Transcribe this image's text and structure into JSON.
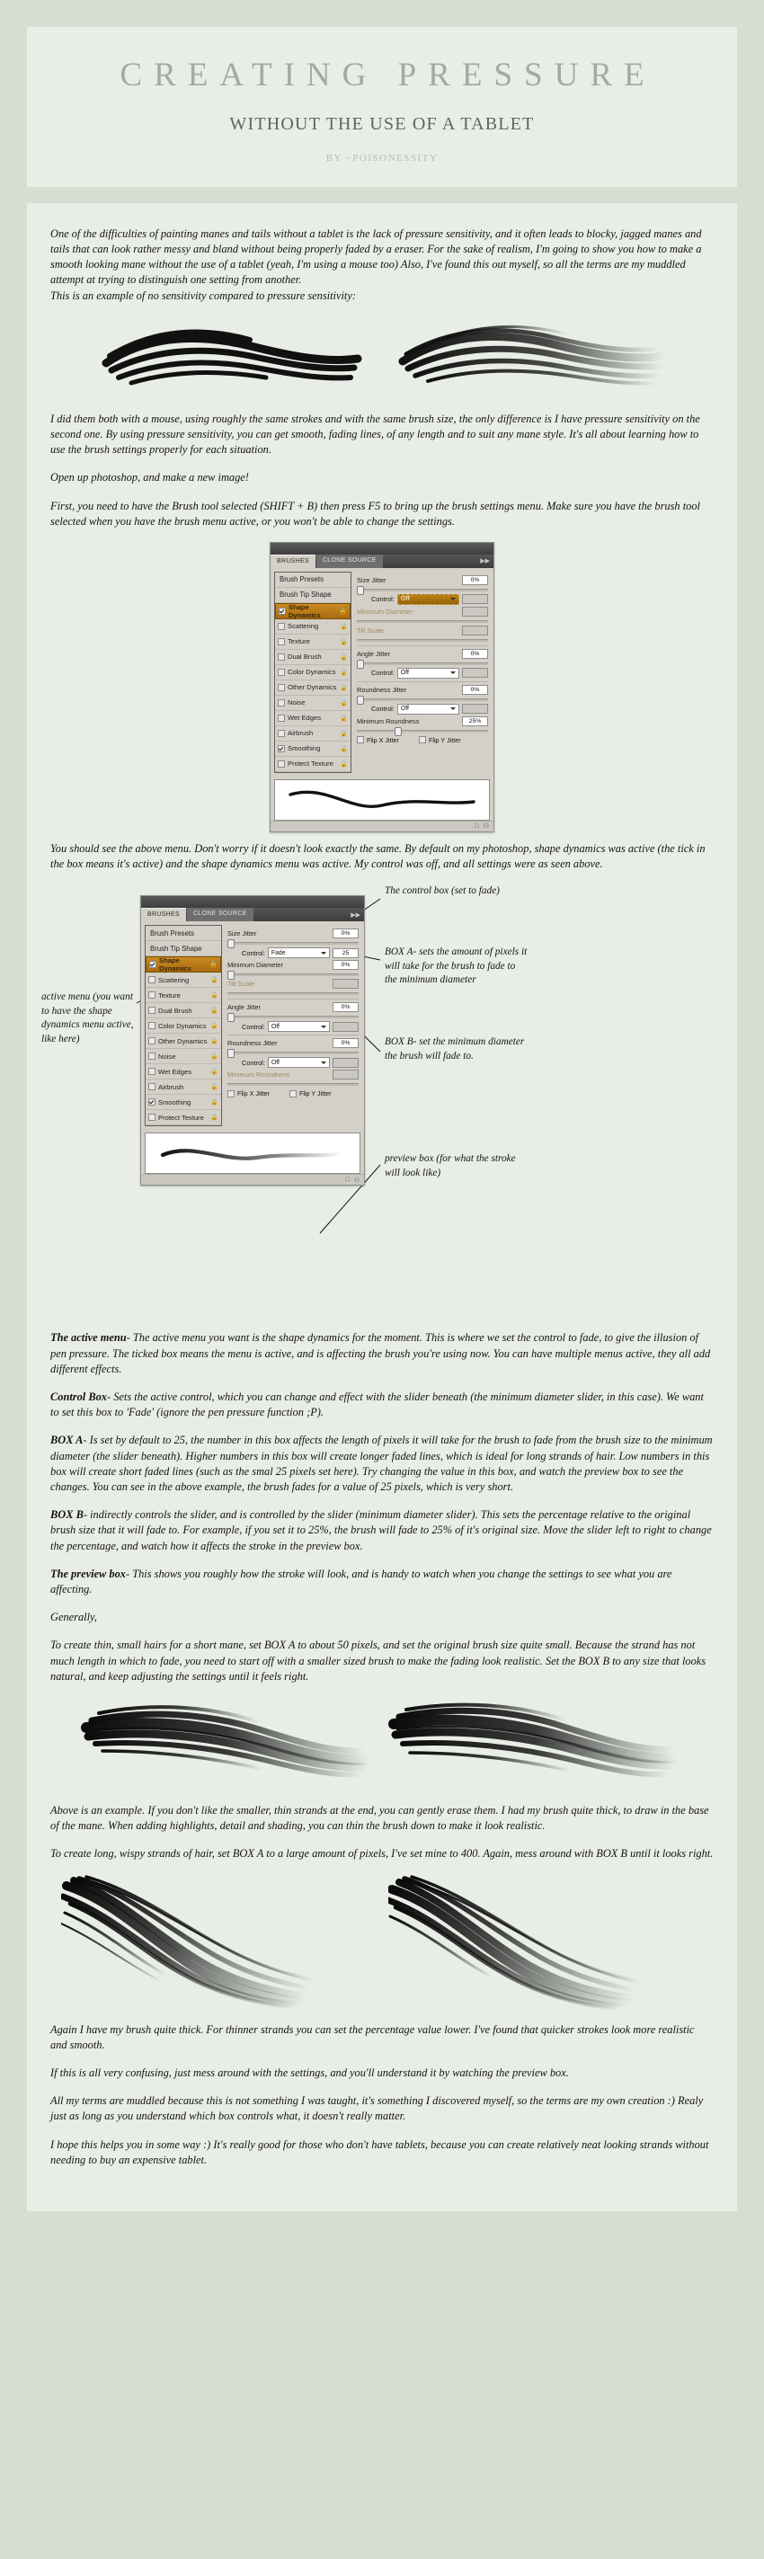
{
  "banner": {
    "title": "CREATING PRESSURE",
    "subtitle": "WITHOUT THE USE OF A TABLET",
    "byline": "BY ~POISONESSITY"
  },
  "colors": {
    "page_background": "#d6ded2",
    "sheet_background": "#e8eee6",
    "title_text": "#a3aaa1",
    "subtitle_text": "#5e6460",
    "body_text": "#15120e",
    "photoshop_panel": "#d4d0c8",
    "photoshop_highlight": "#b5791a"
  },
  "paragraphs": {
    "intro": "One of the difficulties of painting manes and tails without a tablet is the lack of pressure sensitivity, and it often leads to blocky, jagged manes and tails that can look rather messy and bland without being properly faded by a eraser. For the sake of realism, I'm going to show you how to make a smooth looking mane without the use of a tablet (yeah, I'm using a mouse too) Also, I've found this out myself, so all the terms are my muddled attempt at trying to distinguish one setting from another.",
    "example_caption": "This is an example of no sensitivity compared to pressure sensitivity:",
    "after_example": "I did them both with a mouse, using roughly the same strokes and with the same brush size, the only difference is I have pressure sensitivity on the second one.  By using pressure sensitivity, you can get smooth, fading lines, of any length and to suit any mane style. It's all about learning how to use the brush settings properly for each situation.",
    "open_photoshop": "Open up photoshop, and make a new image!",
    "first_step": "First, you need to have the Brush tool selected (SHIFT + B) then press F5 to bring up the brush settings menu. Make sure you have the brush tool selected when you have the brush menu active, or you won't be able to change the settings.",
    "after_panel1": "You should see the above menu. Don't worry if it doesn't look exactly the same. By default on my photoshop, shape dynamics was active (the tick in the box means it's active) and the shape dynamics menu was active. My control was off,  and all settings were as seen above.",
    "generally": "Generally,",
    "thin_hairs": "To create thin, small hairs for a short mane, set BOX A to about 50 pixels, and set the original brush size quite small. Because the strand has not much length in which to fade, you need to start off with a smaller sized brush to make the fading look realistic. Set the BOX B to any size that looks natural, and keep adjusting the settings until it feels right.",
    "above_example": "Above is an example. If you don't like the smaller, thin strands at the end, you can gently erase them. I had my brush quite thick, to draw in the base of the mane. When adding highlights, detail and shading, you can thin the brush down to make it look realistic.",
    "long_wispy": "To create long, wispy strands of hair, set BOX A to a large amount of pixels, I've set mine to 400. Again, mess around with BOX B until it looks right.",
    "again_thick": "Again I have my brush quite thick. For thinner strands you can set the percentage value lower. I've found that quicker strokes look more realistic and smooth.",
    "confusing": "If this is all very confusing, just mess around with the settings, and you'll understand it by watching the preview box.",
    "muddled_terms": "All my terms are muddled because this is not something I was taught, it's something I discovered myself, so the terms are my own creation :) Realy just as long as you understand which box controls what, it doesn't really matter.",
    "closing": "I hope this helps you in some way :) It's really good for those who don't have tablets, because you can create relatively neat looking strands without needing to buy an expensive tablet."
  },
  "definitions": [
    {
      "term": "The active menu",
      "text": "- The active menu you want is the shape dynamics for the moment. This is where we set the control to fade, to give the illusion of pen pressure. The ticked box means the menu is active, and is affecting the brush you're using now. You can have multiple menus active, they all add different effects."
    },
    {
      "term": "Control Box",
      "text": "- Sets the active control, which you can change and effect with the slider beneath (the minimum diameter slider, in this case). We want to set this box to 'Fade' (ignore the pen pressure function ;P)."
    },
    {
      "term": "BOX A",
      "text": "- Is set by default to 25, the number in this box affects the length of pixels it will take for the brush to fade from the brush size to the minimum diameter (the slider beneath). Higher numbers in this box will create longer faded lines, which is ideal for long strands of hair. Low numbers in this box will create short faded lines (such as the smal 25 pixels set here). Try changing the value in this box, and watch the preview box to see the changes. You can see in the above example, the brush fades for a value of 25 pixels, which is very short."
    },
    {
      "term": "BOX B",
      "text": "- indirectly controls the slider, and is controlled by the slider (minimum diameter slider). This sets the percentage relative to the original brush size that it will fade to. For example, if you set it to 25%, the brush will fade to 25% of it's original size. Move the slider left to right to change the percentage, and watch how it affects the stroke in the preview box."
    },
    {
      "term": "The preview box",
      "text": "- This shows you roughly how the stroke will look, and is handy to watch when you change the settings to see what you are affecting."
    }
  ],
  "panel1": {
    "tabs": {
      "active": "BRUSHES",
      "inactive": "CLONE SOURCE"
    },
    "left_items": [
      {
        "label": "Brush Presets",
        "checkbox": "none",
        "selected": false
      },
      {
        "label": "Brush Tip Shape",
        "checkbox": "none",
        "selected": false
      },
      {
        "label": "Shape Dynamics",
        "checkbox": "checked",
        "selected": true
      },
      {
        "label": "Scattering",
        "checkbox": "unchecked",
        "selected": false
      },
      {
        "label": "Texture",
        "checkbox": "unchecked",
        "selected": false
      },
      {
        "label": "Dual Brush",
        "checkbox": "unchecked",
        "selected": false
      },
      {
        "label": "Color Dynamics",
        "checkbox": "unchecked",
        "selected": false
      },
      {
        "label": "Other Dynamics",
        "checkbox": "unchecked",
        "selected": false
      },
      {
        "label": "Noise",
        "checkbox": "unchecked",
        "selected": false
      },
      {
        "label": "Wet Edges",
        "checkbox": "unchecked",
        "selected": false
      },
      {
        "label": "Airbrush",
        "checkbox": "unchecked",
        "selected": false
      },
      {
        "label": "Smoothing",
        "checkbox": "checked",
        "selected": false
      },
      {
        "label": "Protect Texture",
        "checkbox": "unchecked",
        "selected": false
      }
    ],
    "size_jitter_label": "Size Jitter",
    "size_jitter_value": "0%",
    "control_label": "Control:",
    "control_value": "Off",
    "minimum_diameter_label": "Minimum Diameter",
    "minimum_diameter_value": "",
    "tilt_scale_label": "Tilt Scale",
    "tilt_scale_value": "",
    "angle_jitter_label": "Angle Jitter",
    "angle_jitter_value": "0%",
    "angle_control_value": "Off",
    "roundness_jitter_label": "Roundness Jitter",
    "roundness_jitter_value": "0%",
    "roundness_control_value": "Off",
    "minimum_roundness_label": "Minimum Roundness",
    "minimum_roundness_value": "25%",
    "flip_x_label": "Flip X Jitter",
    "flip_y_label": "Flip Y Jitter"
  },
  "panel2": {
    "tabs": {
      "active": "BRUSHES",
      "inactive": "CLONE SOURCE"
    },
    "size_jitter_label": "Size Jitter",
    "size_jitter_value": "0%",
    "control_label": "Control:",
    "control_value": "Fade",
    "box_a_value": "25",
    "minimum_diameter_label": "Minimum Diameter",
    "minimum_diameter_value": "0%",
    "tilt_scale_label": "Tilt Scale",
    "tilt_scale_value": "",
    "angle_jitter_label": "Angle Jitter",
    "angle_jitter_value": "0%",
    "angle_control_value": "Off",
    "roundness_jitter_label": "Roundness Jitter",
    "roundness_jitter_value": "0%",
    "roundness_control_value": "Off",
    "minimum_roundness_label": "Minimum Roundness",
    "minimum_roundness_value": "",
    "flip_x_label": "Flip X Jitter",
    "flip_y_label": "Flip Y Jitter"
  },
  "annotations": {
    "control_box": "The control box (set to fade)",
    "box_a": "BOX A- sets the amount of pixels it will take for the brush to fade to the minimum diameter",
    "box_b": "BOX B- set the minimum diameter the brush will fade to.",
    "preview_box": "preview box (for what the stroke will look like)",
    "active_menu": "active menu (you want to have the shape dynamics menu active, like here)"
  }
}
